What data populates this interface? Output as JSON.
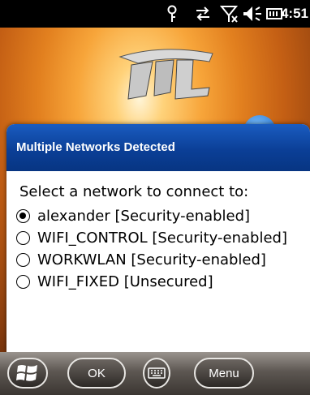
{
  "status_bar": {
    "time": "4:51",
    "icons": [
      "antenna-icon",
      "data-sync-icon",
      "no-signal-icon",
      "volume-icon",
      "battery-icon"
    ]
  },
  "dialog": {
    "title": "Multiple Networks Detected",
    "prompt": "Select a network to connect to:",
    "options": [
      {
        "label": "alexander [Security-enabled]",
        "selected": true
      },
      {
        "label": "WIFI_CONTROL [Security-enabled]",
        "selected": false
      },
      {
        "label": "WORKWLAN [Security-enabled]",
        "selected": false
      },
      {
        "label": "WIFI_FIXED [Unsecured]",
        "selected": false
      }
    ]
  },
  "taskbar": {
    "start_icon": "windows-flag-icon",
    "ok_label": "OK",
    "keyboard_icon": "keyboard-icon",
    "menu_label": "Menu"
  },
  "colors": {
    "title_bar": "#0b3f97",
    "wallpaper_accent": "#f7a53a"
  }
}
